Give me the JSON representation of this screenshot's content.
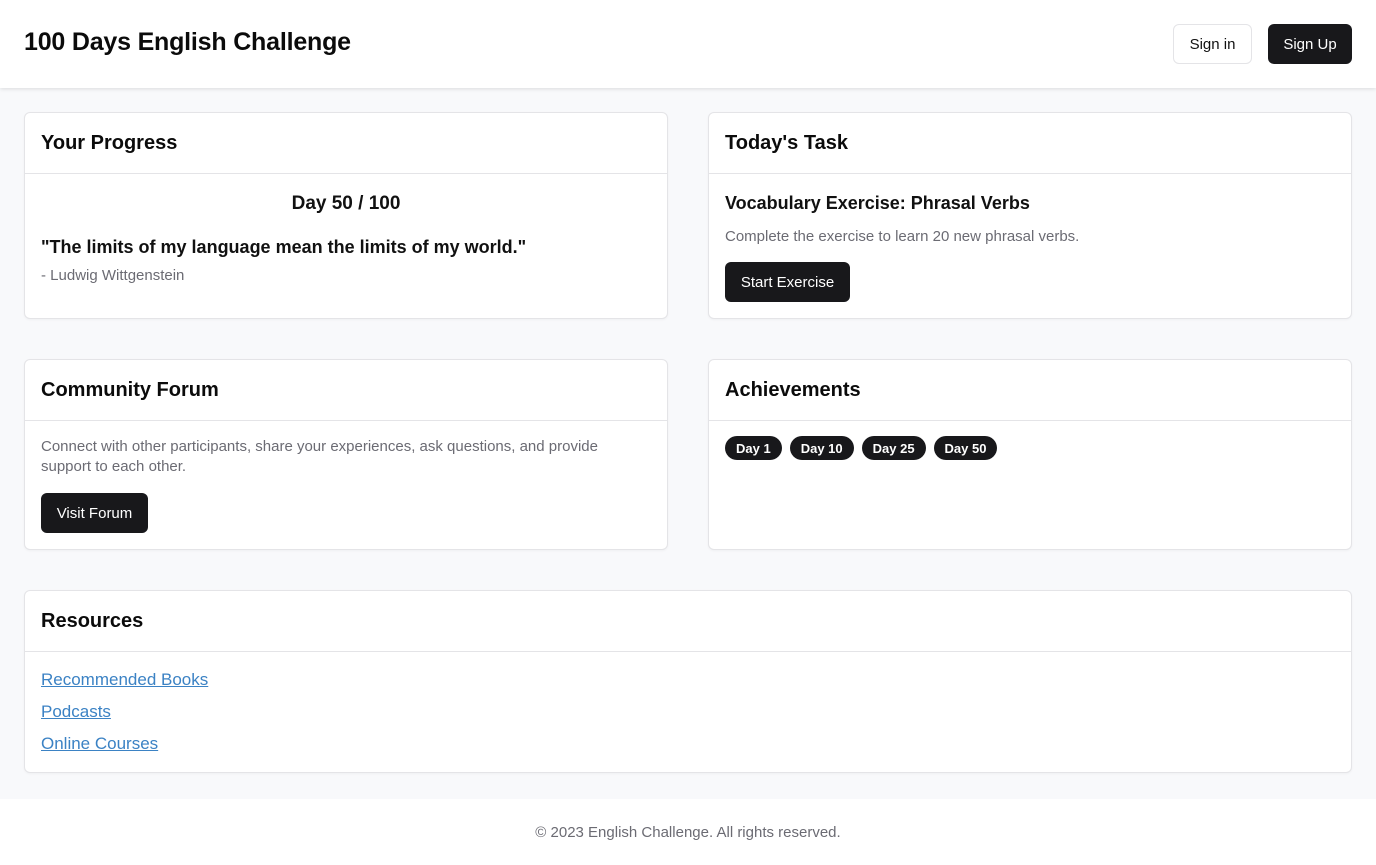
{
  "header": {
    "title": "100 Days English Challenge",
    "sign_in_label": "Sign in",
    "sign_up_label": "Sign Up"
  },
  "progress": {
    "title": "Your Progress",
    "day_text": "Day 50 / 100",
    "current_day": 50,
    "total_days": 100,
    "quote": "\"The limits of my language mean the limits of my world.\"",
    "quote_author": "- Ludwig Wittgenstein"
  },
  "task": {
    "title": "Today's Task",
    "exercise_title": "Vocabulary Exercise: Phrasal Verbs",
    "description": "Complete the exercise to learn 20 new phrasal verbs.",
    "button_label": "Start Exercise"
  },
  "forum": {
    "title": "Community Forum",
    "description": "Connect with other participants, share your experiences, ask questions, and provide support to each other.",
    "button_label": "Visit Forum"
  },
  "achievements": {
    "title": "Achievements",
    "badges": [
      "Day 1",
      "Day 10",
      "Day 25",
      "Day 50"
    ]
  },
  "resources": {
    "title": "Resources",
    "links": [
      "Recommended Books",
      "Podcasts",
      "Online Courses"
    ]
  },
  "footer": {
    "text": "© 2023 English Challenge. All rights reserved."
  },
  "colors": {
    "page_background": "#f8f9fb",
    "primary_button": "#18181b",
    "link": "#3b82c4",
    "muted_text": "#6b6b73",
    "border": "#e4e4e7"
  }
}
